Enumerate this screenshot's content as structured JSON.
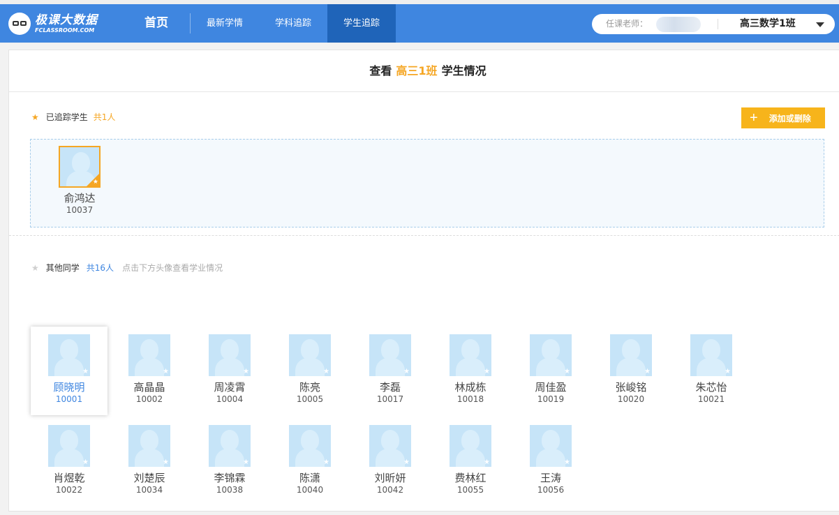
{
  "brand": {
    "name": "极课大数据",
    "sub": "FCLASSROOM.COM"
  },
  "nav": {
    "home": "首页",
    "items": [
      {
        "label": "最新学情"
      },
      {
        "label": "学科追踪"
      },
      {
        "label": "学生追踪",
        "active": true
      }
    ]
  },
  "teacher": {
    "label": "任课老师：",
    "class_selected": "高三数学1班"
  },
  "page": {
    "prefix": "查看",
    "class_name": "高三1班",
    "suffix": "学生情况"
  },
  "tracked_section": {
    "title": "已追踪学生",
    "count": "共1人",
    "add_button": "添加或删除",
    "students": [
      {
        "name": "俞鸿达",
        "id": "10037"
      }
    ]
  },
  "others_section": {
    "title": "其他同学",
    "count": "共16人",
    "hint": "点击下方头像查看学业情况",
    "students": [
      {
        "name": "顾晓明",
        "id": "10001",
        "selected": true
      },
      {
        "name": "高晶晶",
        "id": "10002"
      },
      {
        "name": "周凌霄",
        "id": "10004"
      },
      {
        "name": "陈亮",
        "id": "10005"
      },
      {
        "name": "李磊",
        "id": "10017"
      },
      {
        "name": "林成栋",
        "id": "10018"
      },
      {
        "name": "周佳盈",
        "id": "10019"
      },
      {
        "name": "张峻铭",
        "id": "10020"
      },
      {
        "name": "朱芯怡",
        "id": "10021"
      },
      {
        "name": "肖煜乾",
        "id": "10022"
      },
      {
        "name": "刘楚辰",
        "id": "10034"
      },
      {
        "name": "李锦霖",
        "id": "10038"
      },
      {
        "name": "陈潇",
        "id": "10040"
      },
      {
        "name": "刘昕妍",
        "id": "10042"
      },
      {
        "name": "费林红",
        "id": "10055"
      },
      {
        "name": "王涛",
        "id": "10056"
      }
    ]
  },
  "colors": {
    "nav_blue": "#3f86e0",
    "nav_active": "#1f64b9",
    "accent_orange": "#f5a623",
    "button_yellow": "#f7b41b"
  }
}
